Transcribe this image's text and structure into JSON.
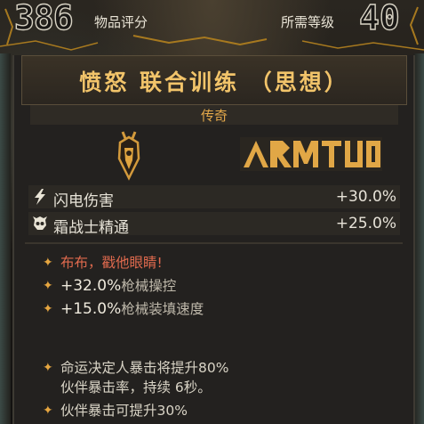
{
  "header": {
    "score": "386",
    "score_label": "物品评分",
    "required_level_label": "所需等级",
    "required_level": "40"
  },
  "item": {
    "title": "愤怒 联合训练 （思想）",
    "rarity": "传奇",
    "brand": "ARMATUM",
    "stats": [
      {
        "icon": "lightning-icon",
        "name": "闪电伤害",
        "value": "+30.0%"
      },
      {
        "icon": "skull-icon",
        "name": "霜战士精通",
        "value": "+25.0%"
      }
    ]
  },
  "talents": {
    "quote": "布布，戳他眼睛!",
    "mod1_value": "+32.0%",
    "mod1_label": "枪械操控",
    "mod2_value": "+15.0%",
    "mod2_label": "枪械装填速度",
    "effect1_a": "命运决定人暴击将提升80%",
    "effect1_b": "伙伴暴击率，持续 6秒。",
    "effect2": "伙伴暴击可提升30%"
  },
  "colors": {
    "title": "#f2c46a",
    "rarity": "#e5a94a",
    "quote": "#e06a4e",
    "star": "#e6a640"
  }
}
